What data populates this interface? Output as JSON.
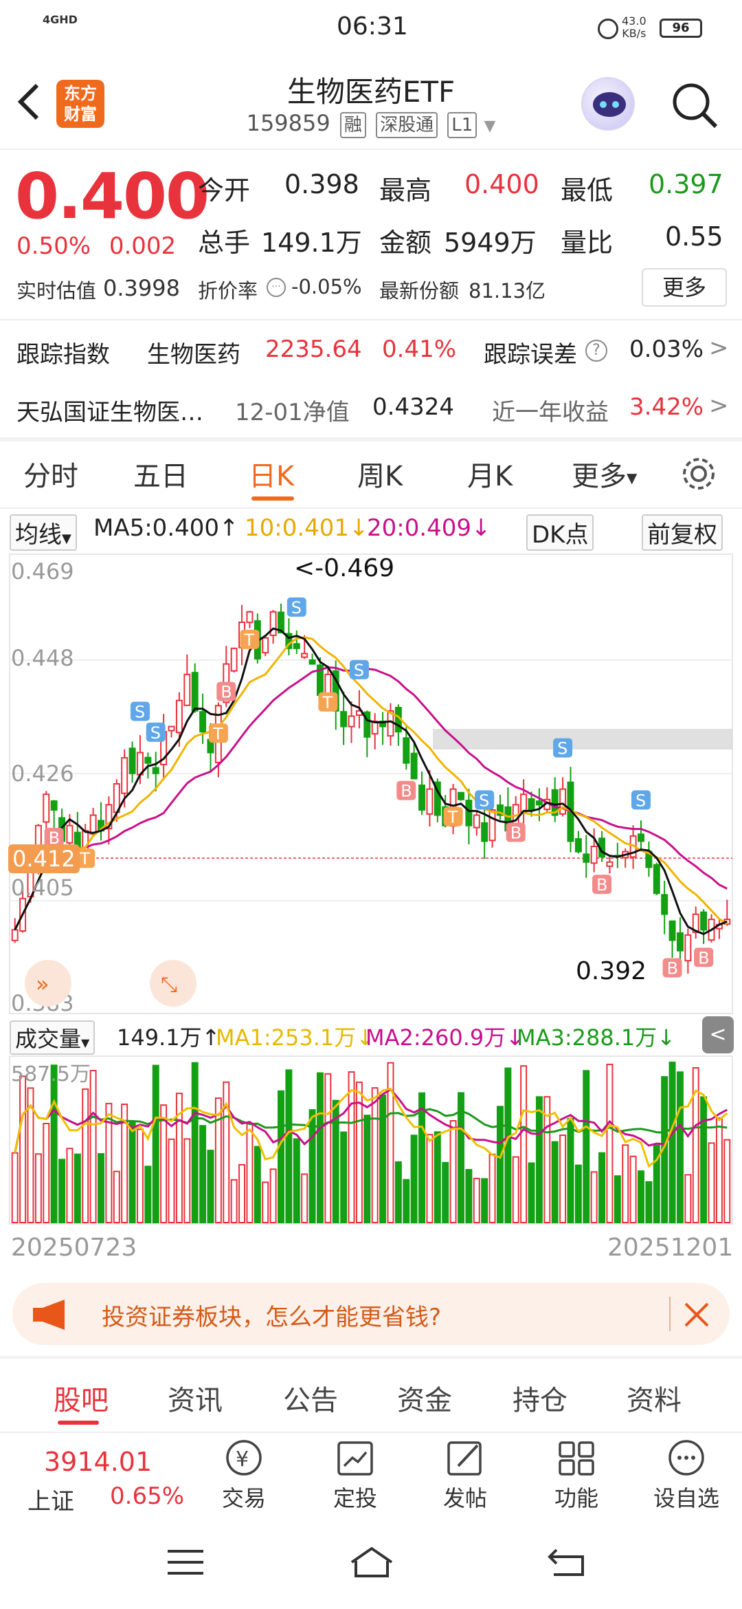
{
  "status": {
    "time": "06:31",
    "network": "4GHD",
    "speed_value": "43.0",
    "speed_unit": "KB/s",
    "battery": "96"
  },
  "header": {
    "logo_line1": "东方",
    "logo_line2": "财富",
    "title": "生物医药ETF",
    "code": "159859",
    "tags": [
      "融",
      "深股通",
      "L1"
    ]
  },
  "quote": {
    "price": "0.400",
    "pct": "0.50%",
    "change": "0.002",
    "open_label": "今开",
    "open": "0.398",
    "high_label": "最高",
    "high": "0.400",
    "low_label": "最低",
    "low": "0.397",
    "volume_label": "总手",
    "volume": "149.1万",
    "amount_label": "金额",
    "amount": "5949万",
    "ratio_label": "量比",
    "ratio": "0.55",
    "iopv_label": "实时估值",
    "iopv": "0.3998",
    "discount_label": "折价率",
    "discount": "-0.05%",
    "shares_label": "最新份额",
    "shares": "81.13亿",
    "more": "更多"
  },
  "tracking": {
    "label": "跟踪指数",
    "index": "生物医药",
    "value": "2235.64",
    "pct": "0.41%",
    "error_label": "跟踪误差",
    "error": "0.03%"
  },
  "fund": {
    "name": "天弘国证生物医…",
    "nav_label": "12-01净值",
    "nav": "0.4324",
    "return_label": "近一年收益",
    "return": "3.42%"
  },
  "tabs": [
    "分时",
    "五日",
    "日K",
    "周K",
    "月K",
    "更多"
  ],
  "ma": {
    "selector": "均线",
    "ma5": "MA5:0.400↑",
    "ma10": "10:0.401↓",
    "ma20": "20:0.409↓",
    "dk": "DK点",
    "adjust": "前复权"
  },
  "kline_labels": {
    "y_top": "0.469",
    "y_2": "0.448",
    "y_3": "0.426",
    "y_4": "0.405",
    "y_bottom": "0.383",
    "current": "0.412",
    "max_note": "<-0.469",
    "min_note": "0.392"
  },
  "volume": {
    "selector": "成交量",
    "vol": "149.1万↑",
    "ma1": "MA1:253.1万↓",
    "ma2": "MA2:260.9万↓",
    "ma3": "MA3:288.1万↓",
    "y_top": "587.5万"
  },
  "dates": {
    "start": "20250723",
    "end": "20251201"
  },
  "promo": {
    "text": "投资证券板块，怎么才能更省钱?"
  },
  "bottom_tabs": [
    "股吧",
    "资讯",
    "公告",
    "资金",
    "持仓",
    "资料"
  ],
  "footer": {
    "index_value": "3914.01",
    "index_name": "上证",
    "index_pct": "0.65%",
    "items": [
      "交易",
      "定投",
      "发帖",
      "功能",
      "设自选"
    ]
  },
  "chart_data": {
    "type": "candlestick",
    "x_start": "20250723",
    "x_end": "20251201",
    "ylim": [
      0.383,
      0.469
    ],
    "close": [
      0.398,
      0.404,
      0.41,
      0.418,
      0.424,
      0.421,
      0.415,
      0.418,
      0.413,
      0.417,
      0.42,
      0.417,
      0.422,
      0.426,
      0.431,
      0.428,
      0.432,
      0.43,
      0.428,
      0.436,
      0.437,
      0.442,
      0.447,
      0.44,
      0.436,
      0.432,
      0.441,
      0.449,
      0.452,
      0.457,
      0.459,
      0.45,
      0.454,
      0.459,
      0.455,
      0.452,
      0.452,
      0.451,
      0.449,
      0.443,
      0.447,
      0.44,
      0.437,
      0.439,
      0.44,
      0.435,
      0.438,
      0.437,
      0.44,
      0.436,
      0.43,
      0.427,
      0.421,
      0.425,
      0.42,
      0.418,
      0.425,
      0.423,
      0.418,
      0.42,
      0.415,
      0.421,
      0.42,
      0.417,
      0.422,
      0.424,
      0.421,
      0.422,
      0.423,
      0.42,
      0.425,
      0.415,
      0.413,
      0.411,
      0.414,
      0.412,
      0.411,
      0.412,
      0.413,
      0.416,
      0.415,
      0.41,
      0.405,
      0.401,
      0.396,
      0.394,
      0.397,
      0.401,
      0.398,
      0.4,
      0.399,
      0.4
    ]
  }
}
